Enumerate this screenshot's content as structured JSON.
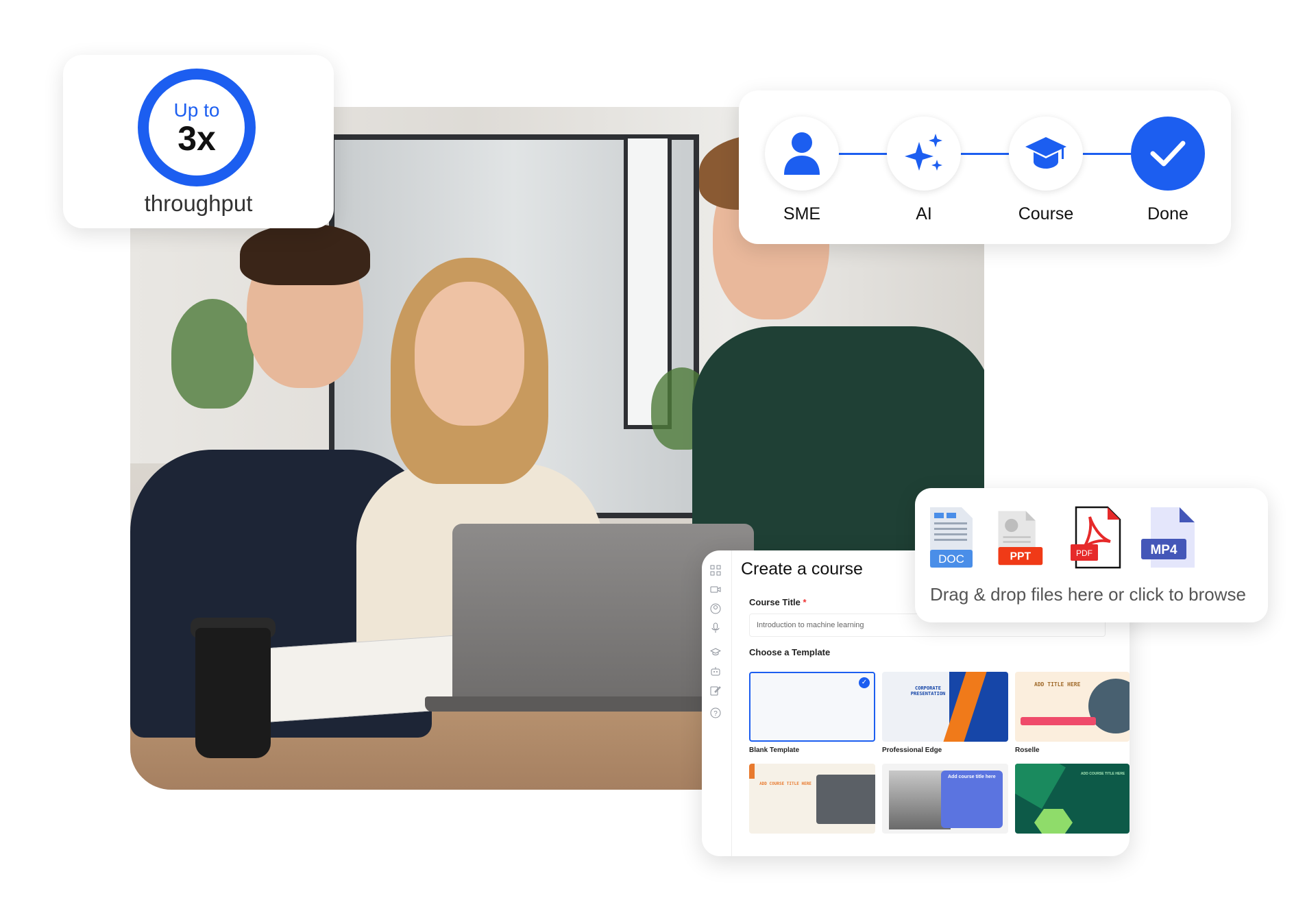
{
  "stat": {
    "prefix": "Up to",
    "value": "3x",
    "caption": "throughput"
  },
  "workflow": {
    "steps": [
      {
        "label": "SME",
        "icon": "person-icon"
      },
      {
        "label": "AI",
        "icon": "sparkle-icon"
      },
      {
        "label": "Course",
        "icon": "graduation-cap-icon"
      },
      {
        "label": "Done",
        "icon": "checkmark-icon"
      }
    ]
  },
  "course": {
    "heading": "Create a course",
    "title_label": "Course Title",
    "required_mark": "*",
    "title_placeholder": "Introduction to machine learning",
    "template_label": "Choose a Template",
    "templates": [
      {
        "name": "Blank Template",
        "selected": true,
        "heading": ""
      },
      {
        "name": "Professional Edge",
        "selected": false,
        "heading": "CORPORATE PRESENTATION"
      },
      {
        "name": "Roselle",
        "selected": false,
        "heading": "ADD TITLE HERE"
      },
      {
        "name": "",
        "selected": false,
        "heading": "ADD COURSE TITLE HERE"
      },
      {
        "name": "",
        "selected": false,
        "heading": "Add course title here"
      },
      {
        "name": "",
        "selected": false,
        "heading": "ADD COURSE TITLE HERE"
      }
    ],
    "rail_icons": [
      "grid-icon",
      "video-icon",
      "user-circle-icon",
      "microphone-icon",
      "graduation-cap-icon",
      "robot-icon",
      "edit-icon",
      "help-icon"
    ]
  },
  "upload": {
    "files": [
      {
        "type": "DOC",
        "color": "#4a8ee8"
      },
      {
        "type": "PPT",
        "color": "#f03a17"
      },
      {
        "type": "PDF",
        "color": "#e62a2a"
      },
      {
        "type": "MP4",
        "color": "#4457b8"
      }
    ],
    "hint": "Drag & drop files here or click to browse"
  },
  "colors": {
    "accent": "#1c5ef0"
  }
}
